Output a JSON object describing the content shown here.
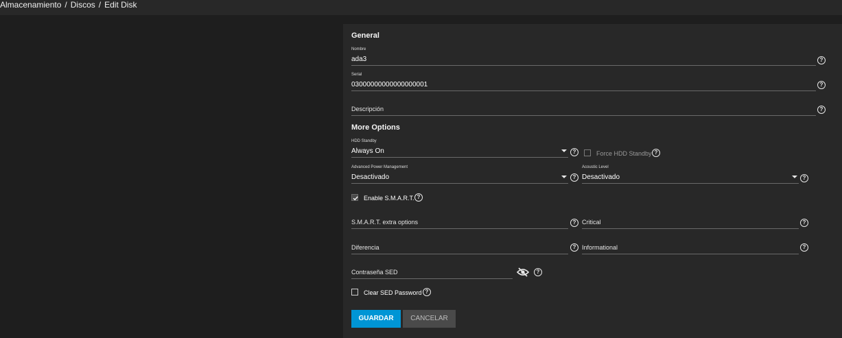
{
  "breadcrumb": {
    "items": [
      "Almacenamiento",
      "Discos",
      "Edit Disk"
    ],
    "separator": "/"
  },
  "general": {
    "title": "General",
    "name": {
      "label": "Nombre",
      "value": "ada3"
    },
    "serial": {
      "label": "Serial",
      "value": "03000000000000000001"
    },
    "description": {
      "placeholder": "Descripción"
    }
  },
  "more_options": {
    "title": "More Options",
    "hdd_standby": {
      "label": "HDD Standby",
      "value": "Always On"
    },
    "force_hdd_standby": {
      "label": "Force HDD Standby",
      "checked": false
    },
    "apm": {
      "label": "Advanced Power Management",
      "value": "Desactivado"
    },
    "acoustic": {
      "label": "Acoustic Level",
      "value": "Desactivado"
    },
    "enable_smart": {
      "label": "Enable S.M.A.R.T.",
      "checked": true
    },
    "smart_extra": {
      "placeholder": "S.M.A.R.T. extra options"
    },
    "critical": {
      "placeholder": "Critical"
    },
    "difference": {
      "placeholder": "Diferencia"
    },
    "informational": {
      "placeholder": "Informational"
    },
    "sed_password": {
      "placeholder": "Contraseña SED"
    },
    "clear_sed": {
      "label": "Clear SED Password",
      "checked": false
    }
  },
  "actions": {
    "save": "GUARDAR",
    "cancel": "CANCELAR"
  },
  "icons": {
    "help": "help-circle-icon",
    "caret": "caret-down-icon",
    "eye": "eye-off-icon",
    "check": "check-icon"
  },
  "colors": {
    "primary": "#0095d5",
    "background": "#1e1e1e",
    "card": "#282828"
  }
}
